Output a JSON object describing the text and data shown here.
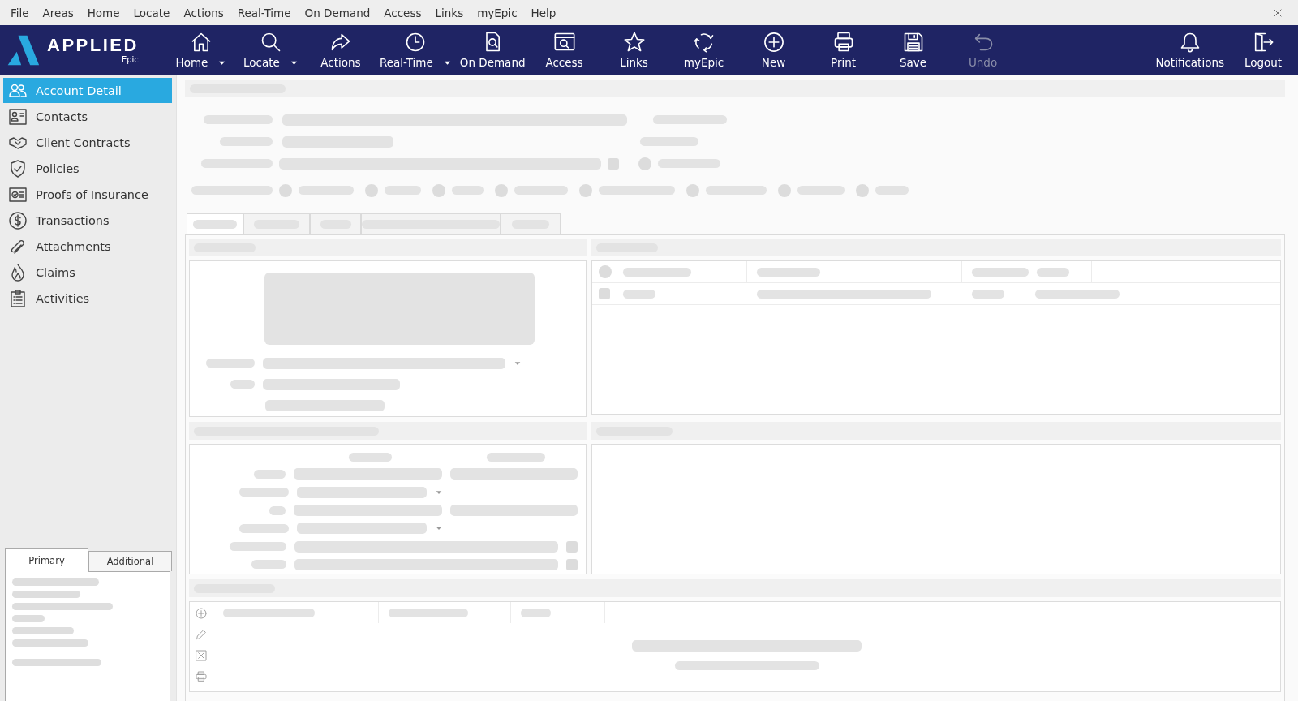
{
  "menu_bar": {
    "items": [
      "File",
      "Areas",
      "Home",
      "Locate",
      "Actions",
      "Real-Time",
      "On Demand",
      "Access",
      "Links",
      "myEpic",
      "Help"
    ]
  },
  "toolbar": {
    "logo": {
      "name": "APPLIED",
      "sub": "Epic"
    },
    "buttons": [
      {
        "label": "Home",
        "dropdown": true,
        "disabled": false
      },
      {
        "label": "Locate",
        "dropdown": true,
        "disabled": false
      },
      {
        "label": "Actions",
        "dropdown": false,
        "disabled": false
      },
      {
        "label": "Real-Time",
        "dropdown": true,
        "disabled": false
      },
      {
        "label": "On Demand",
        "dropdown": false,
        "disabled": false
      },
      {
        "label": "Access",
        "dropdown": false,
        "disabled": false
      },
      {
        "label": "Links",
        "dropdown": false,
        "disabled": false
      },
      {
        "label": "myEpic",
        "dropdown": false,
        "disabled": false
      },
      {
        "label": "New",
        "dropdown": false,
        "disabled": false
      },
      {
        "label": "Print",
        "dropdown": false,
        "disabled": false
      },
      {
        "label": "Save",
        "dropdown": false,
        "disabled": false
      },
      {
        "label": "Undo",
        "dropdown": false,
        "disabled": true
      }
    ],
    "right_buttons": [
      {
        "label": "Notifications",
        "dropdown": false,
        "disabled": false
      },
      {
        "label": "Logout",
        "dropdown": false,
        "disabled": false
      }
    ]
  },
  "sidebar": {
    "items": [
      {
        "label": "Account Detail",
        "selected": true
      },
      {
        "label": "Contacts",
        "selected": false
      },
      {
        "label": "Client Contracts",
        "selected": false
      },
      {
        "label": "Policies",
        "selected": false
      },
      {
        "label": "Proofs of Insurance",
        "selected": false
      },
      {
        "label": "Transactions",
        "selected": false
      },
      {
        "label": "Attachments",
        "selected": false
      },
      {
        "label": "Claims",
        "selected": false
      },
      {
        "label": "Activities",
        "selected": false
      }
    ],
    "info_tabs": [
      {
        "label": "Primary",
        "selected": true
      },
      {
        "label": "Additional",
        "selected": false
      }
    ]
  }
}
